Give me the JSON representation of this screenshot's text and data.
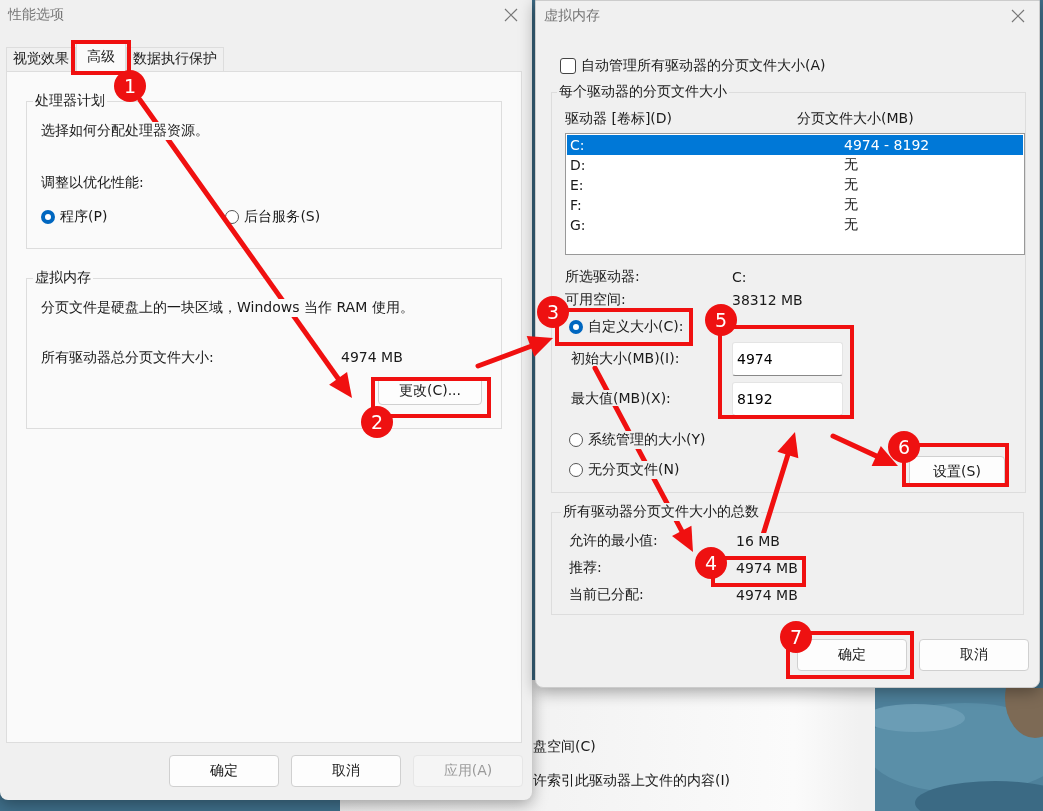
{
  "performance_window": {
    "title": "性能选项",
    "tabs": [
      {
        "label": "视觉效果",
        "selected": false
      },
      {
        "label": "高级",
        "selected": true
      },
      {
        "label": "数据执行保护",
        "selected": false
      }
    ],
    "processor_group": {
      "title": "处理器计划",
      "description": "选择如何分配处理器资源。",
      "prompt": "调整以优化性能:",
      "options": [
        {
          "label": "程序(P)",
          "selected": true
        },
        {
          "label": "后台服务(S)",
          "selected": false
        }
      ]
    },
    "virtual_memory_group": {
      "title": "虚拟内存",
      "description": "分页文件是硬盘上的一块区域，Windows 当作 RAM 使用。",
      "total_label": "所有驱动器总分页文件大小:",
      "total_value": "4974 MB",
      "change_button": "更改(C)..."
    },
    "buttons": [
      {
        "label": "确定",
        "disabled": false
      },
      {
        "label": "取消",
        "disabled": false
      },
      {
        "label": "应用(A)",
        "disabled": true
      }
    ]
  },
  "virtual_memory_window": {
    "title": "虚拟内存",
    "auto_manage": {
      "label": "自动管理所有驱动器的分页文件大小(A)",
      "checked": false
    },
    "drives_group": {
      "title": "每个驱动器的分页文件大小",
      "columns": [
        "驱动器 [卷标](D)",
        "分页文件大小(MB)"
      ],
      "rows": [
        {
          "drive": "C:",
          "size": "4974 - 8192",
          "selected": true
        },
        {
          "drive": "D:",
          "size": "无",
          "selected": false
        },
        {
          "drive": "E:",
          "size": "无",
          "selected": false
        },
        {
          "drive": "F:",
          "size": "无",
          "selected": false
        },
        {
          "drive": "G:",
          "size": "无",
          "selected": false
        }
      ],
      "selected_drive_label": "所选驱动器:",
      "selected_drive": "C:",
      "free_space_label": "可用空间:",
      "free_space": "38312 MB",
      "size_options": [
        {
          "label": "自定义大小(C):",
          "selected": true
        },
        {
          "label": "系统管理的大小(Y)",
          "selected": false
        },
        {
          "label": "无分页文件(N)",
          "selected": false
        }
      ],
      "initial_size": {
        "label": "初始大小(MB)(I):",
        "value": "4974"
      },
      "maximum_size": {
        "label": "最大值(MB)(X):",
        "value": "8192"
      },
      "set_button": "设置(S)"
    },
    "totals_group": {
      "title": "所有驱动器分页文件大小的总数",
      "rows": [
        {
          "label": "允许的最小值:",
          "value": "16 MB"
        },
        {
          "label": "推荐:",
          "value": "4974 MB"
        },
        {
          "label": "当前已分配:",
          "value": "4974 MB"
        }
      ]
    },
    "buttons": [
      {
        "label": "确定"
      },
      {
        "label": "取消"
      }
    ]
  },
  "background_window": {
    "lines": [
      "盘空间(C)",
      "许索引此驱动器上文件的内容(I)"
    ]
  },
  "annotations": [
    {
      "label": "1"
    },
    {
      "label": "2"
    },
    {
      "label": "3"
    },
    {
      "label": "4"
    },
    {
      "label": "5"
    },
    {
      "label": "6"
    },
    {
      "label": "7"
    }
  ]
}
